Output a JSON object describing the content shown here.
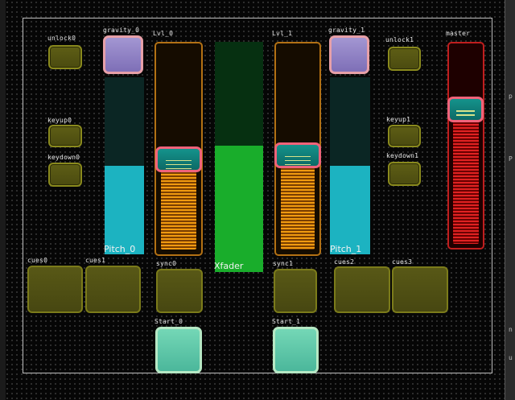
{
  "labels": {
    "unlock0": "unlock0",
    "gravity0": "gravity_0",
    "lvl0": "Lvl_0",
    "lvl1": "Lvl_1",
    "gravity1": "gravity_1",
    "unlock1": "unlock1",
    "master": "master",
    "keyup0": "keyup0",
    "keydown0": "keydown0",
    "keyup1": "keyup1",
    "keydown1": "keydown1",
    "pitch0": "Pitch_0",
    "pitch1": "Pitch_1",
    "xfader": "Xfader",
    "cues0": "cues0",
    "cues1": "cues1",
    "sync0": "sync0",
    "sync1": "sync1",
    "cues2": "cues2",
    "cues3": "cues3",
    "start0": "Start_0",
    "start1": "Start_1"
  },
  "levels": {
    "pitch0": 0.5,
    "pitch1": 0.5,
    "lvl0": 0.45,
    "lvl1": 0.47,
    "xfader": 0.55,
    "master": 0.68
  },
  "colors": {
    "button": "#5e5e15",
    "gravity": "#a396d2",
    "start": "#74d7b6",
    "pitch": "#1cb3c1",
    "level": "#f09a10",
    "xfader": "#19ad2b",
    "master": "#e02222",
    "handle_border": "#f0637a"
  },
  "edge": {
    "glyph1": "p",
    "glyph2": "P",
    "glyph3": "n",
    "glyph4": "u"
  }
}
